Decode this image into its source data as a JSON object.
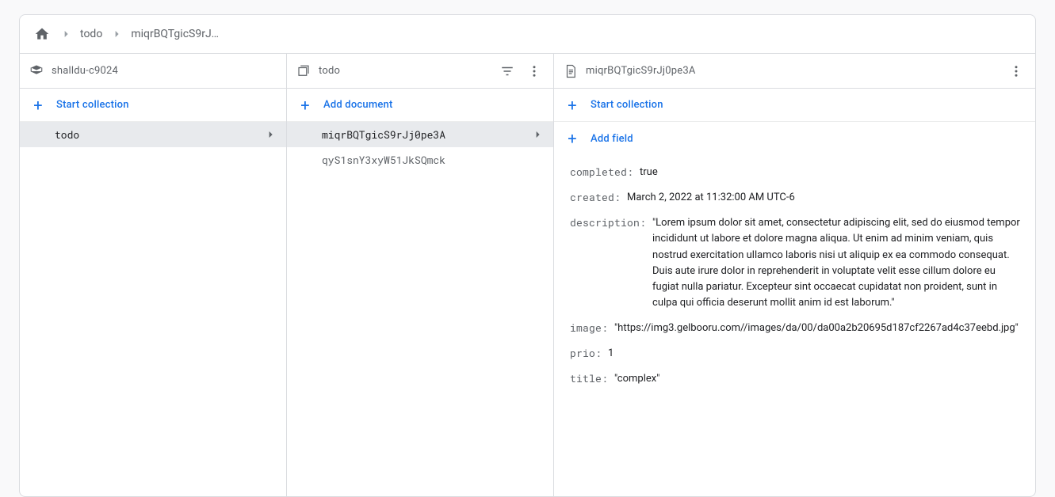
{
  "breadcrumbs": {
    "collection": "todo",
    "doc": "miqrBQTgicS9rJ…"
  },
  "col1": {
    "title": "shalldu-c9024",
    "action": "Start collection",
    "items": [
      {
        "label": "todo",
        "selected": true
      }
    ]
  },
  "col2": {
    "title": "todo",
    "action": "Add document",
    "items": [
      {
        "label": "miqrBQTgicS9rJj0pe3A",
        "selected": true
      },
      {
        "label": "qyS1snY3xyW51JkSQmck",
        "selected": false
      }
    ]
  },
  "col3": {
    "title": "miqrBQTgicS9rJj0pe3A",
    "action_collection": "Start collection",
    "action_field": "Add field",
    "fields": [
      {
        "key": "completed",
        "value": "true"
      },
      {
        "key": "created",
        "value": "March 2, 2022 at 11:32:00 AM UTC-6"
      },
      {
        "key": "description",
        "value": "\"Lorem ipsum dolor sit amet, consectetur adipiscing elit, sed do eiusmod tempor incididunt ut labore et dolore magna aliqua. Ut enim ad minim veniam, quis nostrud exercitation ullamco laboris nisi ut aliquip ex ea commodo consequat. Duis aute irure dolor in reprehenderit in voluptate velit esse cillum dolore eu fugiat nulla pariatur. Excepteur sint occaecat cupidatat non proident, sunt in culpa qui officia deserunt mollit anim id est laborum.\""
      },
      {
        "key": "image",
        "value": "\"https://img3.gelbooru.com//images/da/00/da00a2b20695d187cf2267ad4c37eebd.jpg\""
      },
      {
        "key": "prio",
        "value": "1"
      },
      {
        "key": "title",
        "value": "\"complex\""
      }
    ]
  }
}
